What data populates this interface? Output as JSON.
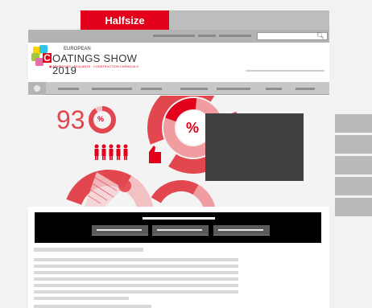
{
  "ad_label": "Halfsize",
  "logo": {
    "line1": "EUROPEAN",
    "c_letter": "C",
    "title": "OATINGS SHOW 2019",
    "subtitle": "◉ ADHESIVES · SEALANTS · CONSTRUCTION CHEMICALS"
  },
  "hero": {
    "big_number": "93",
    "donut_label": "%",
    "ring_label": "%"
  },
  "icons": {
    "search": "search-icon",
    "home": "home-icon",
    "thumbs": "thumbs-up-icon",
    "people": "people-icon"
  },
  "colors": {
    "brand_red": "#e2001a",
    "chart_red": "#e2474f",
    "pink": "#f19ca1"
  }
}
